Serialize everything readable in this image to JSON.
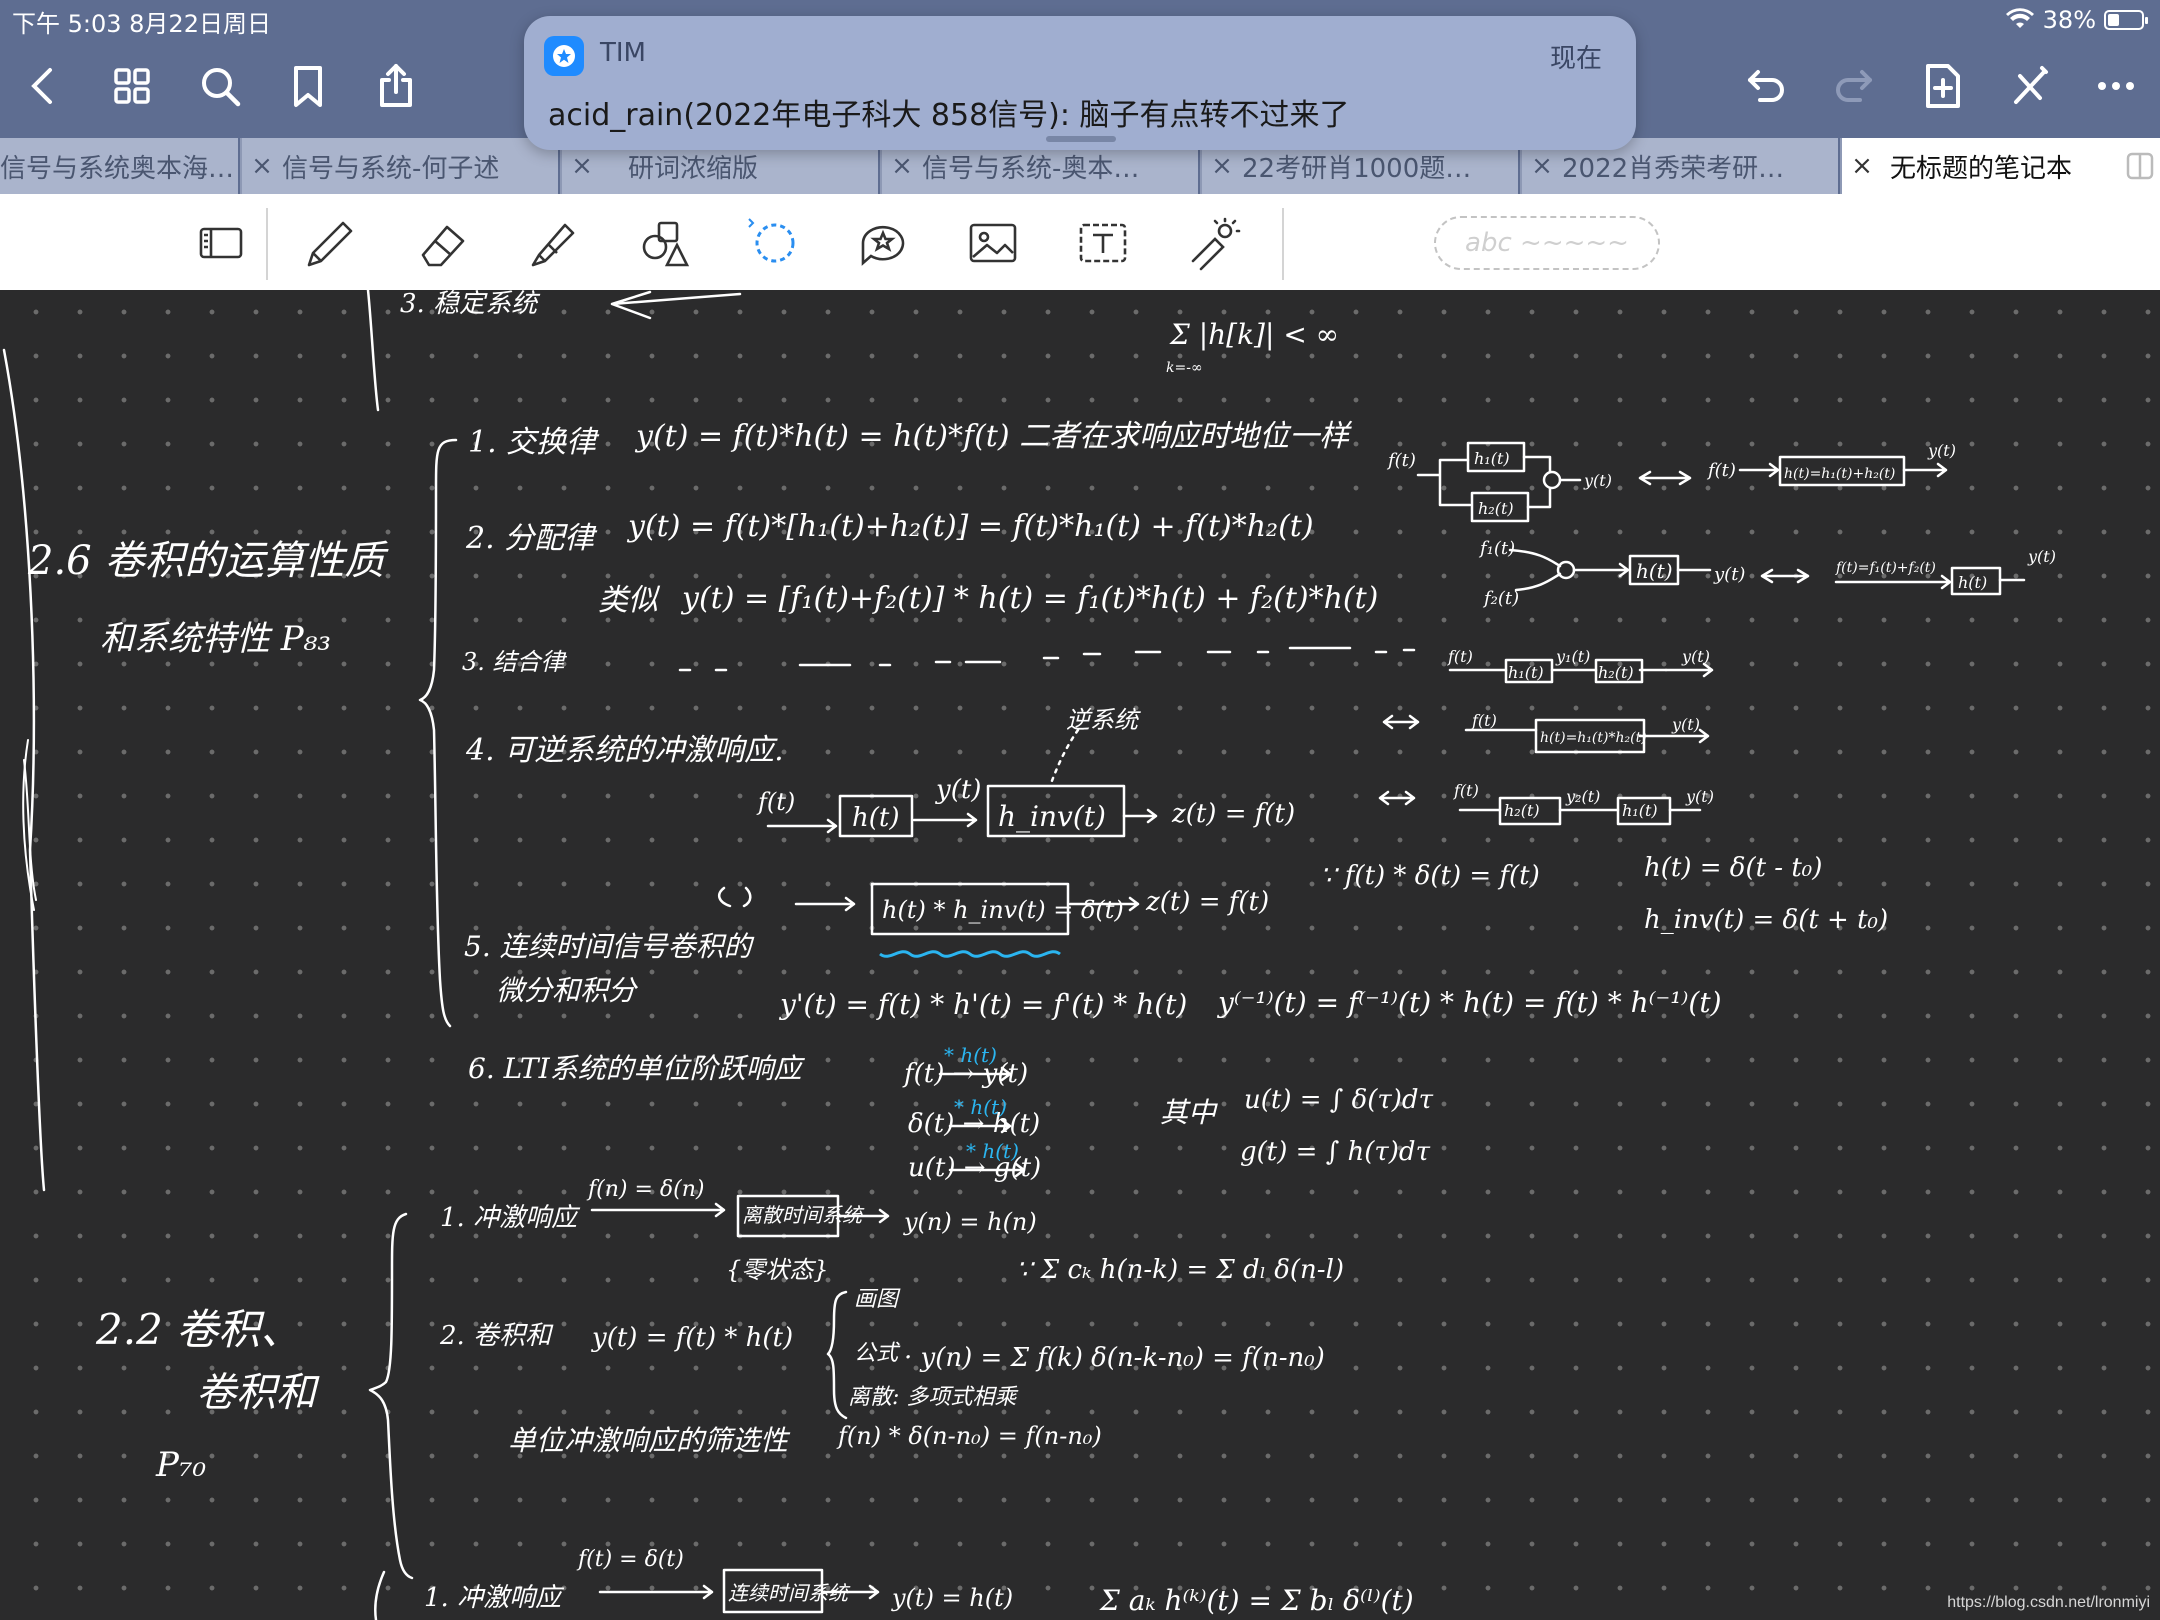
{
  "status_bar": {
    "time_date": "下午 5:03   8月22日周日",
    "battery": "38%"
  },
  "notification": {
    "app": "TIM",
    "time": "现在",
    "message": "acid_rain(2022年电子科大 858信号): 脑子有点转不过来了"
  },
  "nav_icons": [
    "back-icon",
    "grid-icon",
    "search-icon",
    "bookmark-icon",
    "share-icon",
    "undo-icon",
    "redo-icon",
    "add-page-icon",
    "close-toolbar-icon",
    "more-icon"
  ],
  "tabs": [
    {
      "label": "信号与系统奥本海…"
    },
    {
      "label": "信号与系统-何子述"
    },
    {
      "label": "研词浓缩版"
    },
    {
      "label": "信号与系统-奥本…"
    },
    {
      "label": "22考研肖1000题…"
    },
    {
      "label": "2022肖秀荣考研…"
    },
    {
      "label": "无标题的笔记本"
    }
  ],
  "tools": [
    "page-view-icon",
    "pen-icon",
    "eraser-icon",
    "highlighter-icon",
    "shapes-icon",
    "lasso-icon",
    "sticker-icon",
    "image-icon",
    "text-icon",
    "laser-pointer-icon"
  ],
  "search_pill": "abc ~~~~~",
  "notes": {
    "n01": "3. 稳定系统",
    "n02": "Σ |h[k]| < ∞",
    "n03": "k=-∞",
    "n04": "1. 交换律",
    "n05": "y(t) = f(t)*h(t) = h(t)*f(t)  二者在求响应时地位一样",
    "n06": "2. 分配律",
    "n07": "y(t) = f(t)*[h₁(t)+h₂(t)] = f(t)*h₁(t) + f(t)*h₂(t)",
    "n08": "类似",
    "n09": "y(t) = [f₁(t)+f₂(t)] * h(t)  =  f₁(t)*h(t) + f₂(t)*h(t)",
    "n10": "2.6 卷积的运算性质",
    "n11": "和系统特性  P₈₃",
    "n12": "3. 结合律",
    "n13": "4. 可逆系统的冲激响应.",
    "n14": "逆系统",
    "n15": "f(t)",
    "n16": "h(t)",
    "n17": "y(t)",
    "n18": "h_inv(t)",
    "n19": "z(t) = f(t)",
    "n20": "h(t) * h_inv(t) = δ(t)",
    "n21": "z(t) = f(t)",
    "n22": "∵ f(t) * δ(t) = f(t)",
    "n23": "h(t) = δ(t - t₀)",
    "n24": "h_inv(t) = δ(t + t₀)",
    "n25": "5. 连续时间信号卷积的",
    "n26": "微分和积分",
    "n27": "y'(t) = f(t) * h'(t) = f'(t) * h(t)",
    "n28": "y⁽⁻¹⁾(t) = f⁽⁻¹⁾(t) * h(t) = f(t) * h⁽⁻¹⁾(t)",
    "n29": "6. LTI系统的单位阶跃响应",
    "n30": "f(t) → y(t)",
    "n31": "δ(t) → h(t)",
    "n32": "u(t) → g(t)",
    "n33": "* h(t)",
    "n34": "其中",
    "n35": "u(t) = ∫ δ(τ)dτ",
    "n36": "g(t) = ∫ h(τ)dτ",
    "n37": "1. 冲激响应",
    "n38": "f(n) = δ(n)",
    "n39": "离散时间系统",
    "n40": "y(n) = h(n)",
    "n41": "{零状态}",
    "n42": "∵ Σ cₖ h(n-k) = Σ dₗ δ(n-l)",
    "n43": "2.2 卷积、",
    "n44": "卷积和",
    "n45": "P₇₀",
    "n46": "2. 卷积和",
    "n47": "y(t) = f(t) * h(t)",
    "n48": "画图",
    "n49": "公式",
    "n50": "· y(n) = Σ f(k) δ(n-k-n₀)  =  f(n-n₀)",
    "n51": "离散: 多项式相乘",
    "n52": "单位冲激响应的筛选性",
    "n53": "f(n) * δ(n-n₀) = f(n-n₀)",
    "n54": "1. 冲激响应",
    "n55": "f(t) = δ(t)",
    "n56": "连续时间系统",
    "n57": "y(t) = h(t)",
    "n58": "Σ aₖ h⁽ᵏ⁾(t) = Σ bₗ δ⁽ˡ⁾(t)",
    "d01": "f(t)",
    "d02": "h₁(t)",
    "d03": "h₂(t)",
    "d04": "y(t)",
    "d05": "f(t)",
    "d06": "h(t)=h₁(t)+h₂(t)",
    "d07": "y(t)",
    "d08": "f₁(t)",
    "d09": "f₂(t)",
    "d10": "h(t)",
    "d11": "y(t)",
    "d12": "f(t)=f₁(t)+f₂(t)",
    "d13": "h(t)",
    "d14": "y(t)",
    "d15": "f(t)",
    "d16": "h₁(t)",
    "d17": "y₁(t)",
    "d18": "h₂(t)",
    "d19": "y(t)",
    "d20": "f(t)",
    "d21": "h(t)=h₁(t)*h₂(t)",
    "d22": "y(t)",
    "d23": "f(t)",
    "d24": "h₂(t)",
    "d25": "y₂(t)",
    "d26": "h₁(t)",
    "d27": "y(t)"
  },
  "watermark": "https://blog.csdn.net/lronmiyi"
}
